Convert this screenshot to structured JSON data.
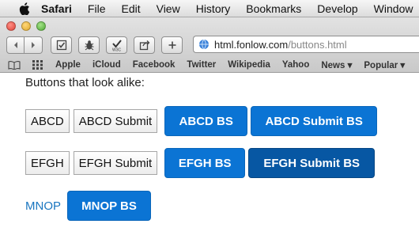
{
  "menubar": {
    "app": "Safari",
    "items": [
      "File",
      "Edit",
      "View",
      "History",
      "Bookmarks",
      "Develop",
      "Window"
    ]
  },
  "toolbar": {
    "address_host": "html.fonlow.com",
    "address_path": "/buttons.html"
  },
  "bookmarks": {
    "items": [
      "Apple",
      "iCloud",
      "Facebook",
      "Twitter",
      "Wikipedia",
      "Yahoo",
      "News ▾",
      "Popular ▾"
    ]
  },
  "page": {
    "heading": "Buttons that look alike:",
    "row1": {
      "plain1": "ABCD",
      "plain2": "ABCD Submit",
      "bs1": "ABCD BS",
      "bs2": "ABCD Submit BS"
    },
    "row2": {
      "plain1": "EFGH",
      "plain2": "EFGH Submit",
      "bs1": "EFGH BS",
      "bs2": "EFGH Submit BS"
    },
    "row3": {
      "link": "MNOP",
      "bs1": "MNOP BS"
    }
  },
  "colors": {
    "bootstrap_blue": "#0b74d4",
    "bootstrap_blue_active": "#0757a3",
    "link_blue": "#1a76c0"
  }
}
